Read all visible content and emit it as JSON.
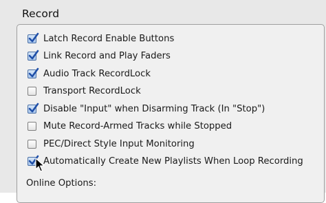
{
  "section": {
    "title": "Record"
  },
  "options": [
    {
      "label": "Latch Record Enable Buttons",
      "checked": true
    },
    {
      "label": "Link Record and Play Faders",
      "checked": true
    },
    {
      "label": "Audio Track RecordLock",
      "checked": true
    },
    {
      "label": "Transport RecordLock",
      "checked": false
    },
    {
      "label": "Disable \"Input\" when Disarming Track (In \"Stop\")",
      "checked": true
    },
    {
      "label": "Mute Record-Armed Tracks while Stopped",
      "checked": false
    },
    {
      "label": "PEC/Direct Style Input Monitoring",
      "checked": false
    },
    {
      "label": "Automatically Create New Playlists When Loop Recording",
      "checked": true
    }
  ],
  "online_options": {
    "title": "Online Options:"
  },
  "colors": {
    "checkmark": "#1f4fa8",
    "panel_bg": "#f0f0f0",
    "border": "#9e9e9e"
  },
  "icons": {
    "checkmark": "checkmark-icon",
    "cursor": "mouse-pointer-icon"
  }
}
